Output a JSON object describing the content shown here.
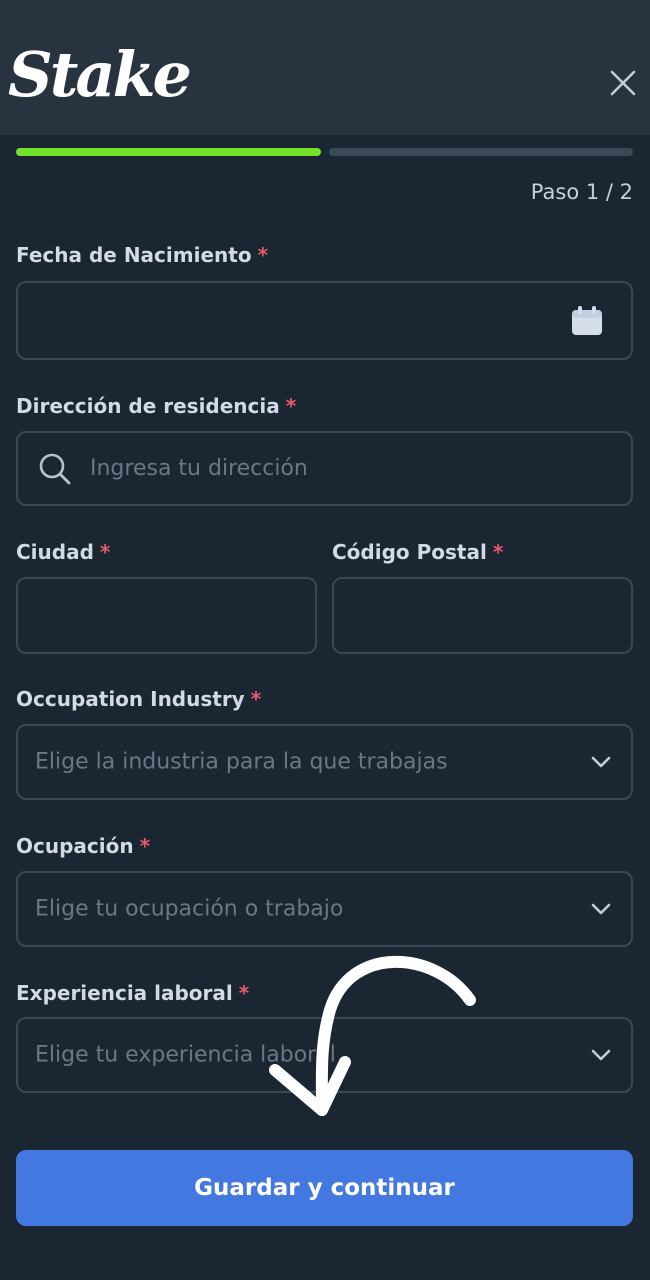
{
  "header": {
    "logo_text": "Stake",
    "close_icon": "close-icon"
  },
  "progress": {
    "step_label": "Paso 1 / 2",
    "current_step": 1,
    "total_steps": 2,
    "active_color": "#72e127"
  },
  "form": {
    "birth_date": {
      "label": "Fecha de Nacimiento",
      "required_mark": "*",
      "value": "",
      "icon": "calendar-icon"
    },
    "address": {
      "label": "Dirección de residencia",
      "required_mark": "*",
      "placeholder": "Ingresa tu dirección",
      "icon": "search-icon"
    },
    "city": {
      "label": "Ciudad",
      "required_mark": "*",
      "value": ""
    },
    "postal_code": {
      "label": "Código Postal",
      "required_mark": "*",
      "value": ""
    },
    "industry": {
      "label": "Occupation Industry",
      "required_mark": "*",
      "placeholder": "Elige la industria para la que trabajas"
    },
    "occupation": {
      "label": "Ocupación",
      "required_mark": "*",
      "placeholder": "Elige tu ocupación o trabajo"
    },
    "experience": {
      "label": "Experiencia laboral",
      "required_mark": "*",
      "placeholder": "Elige tu experiencia laboral"
    }
  },
  "actions": {
    "submit_label": "Guardar y continuar",
    "submit_color": "#4378e0"
  },
  "colors": {
    "background": "#1b2633",
    "header": "#27333f",
    "required": "#e85a6b"
  }
}
